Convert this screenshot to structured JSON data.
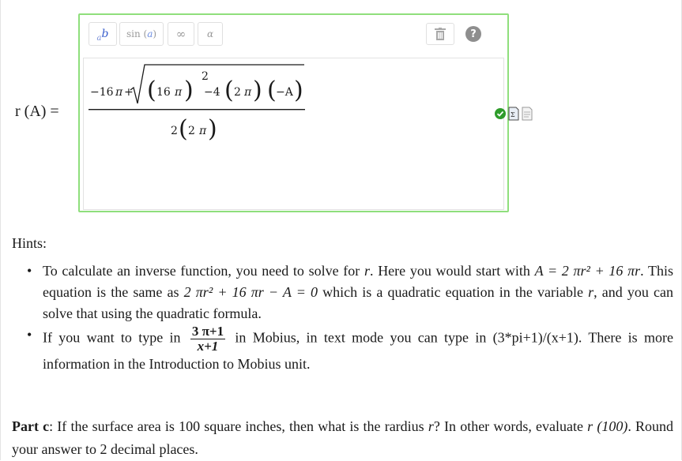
{
  "label": {
    "lhs": "r (A) ="
  },
  "toolbar": {
    "power_base": "a",
    "power_exp": "b",
    "sin_fn": "sin",
    "sin_arg": "a",
    "infinity": "∞",
    "alpha": "α",
    "trash_icon": "trash-icon",
    "help_icon": "help-icon",
    "help_text": "?"
  },
  "math": {
    "t_neg16": "−16",
    "t_pi": "π",
    "t_plus": "+",
    "t_16": "16",
    "t_2": "2",
    "t_neg4": "−4",
    "t_negA": "−A",
    "t_A": "A"
  },
  "hints": {
    "title": "Hints:",
    "h1_a": "To calculate an inverse function, you need to solve for",
    "h1_r": "r",
    "h1_b": ". Here you would start with",
    "h1_eq1": "A = 2 πr² + 16 πr",
    "h1_c": ". This equation is the same as",
    "h1_eq2": "2 πr² + 16 πr − A = 0",
    "h1_d": "which is a quadratic equation in the variable",
    "h1_e": ", and you can solve that using the quadratic formula.",
    "h2_a": "If you want to type in",
    "h2_num": "3 π+1",
    "h2_den": "x+1",
    "h2_b": "in Mobius, in text mode you can type in (3*pi+1)/(x+1). There is more information in the Introduction to Mobius unit."
  },
  "partc": {
    "label": "Part c",
    "text1": ": If the surface area is",
    "num": "100",
    "text2": "square inches, then what is the rardius",
    "r": "r",
    "text3": "? In other words, evaluate",
    "expr": "r (100)",
    "text4": ". Round your answer to 2 decimal places."
  },
  "status": {
    "check_icon": "check-icon",
    "doc1_icon": "equation-doc-icon",
    "doc2_icon": "text-doc-icon"
  },
  "colors": {
    "editor_border": "#8fdf7c",
    "check": "#2e9c2a",
    "accent": "#3a5fcd"
  }
}
